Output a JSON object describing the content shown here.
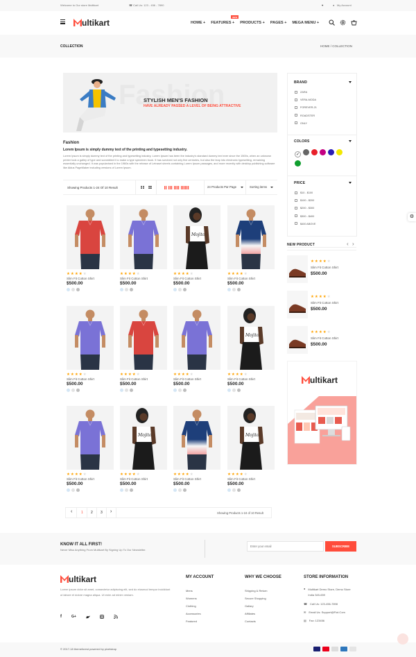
{
  "topbar": {
    "welcome": "Welcome to Our store Multikart",
    "phone": "Call Us: 123 - 456 - 7890",
    "account": "My Account"
  },
  "brand": {
    "logo_tail": "ultikart"
  },
  "nav": {
    "items": [
      "HOME",
      "FEATURES",
      "PRODUCTS",
      "PAGES",
      "MEGA MENU"
    ],
    "features_badge": "NEW"
  },
  "breadcrumb": {
    "title": "COLLECTION",
    "home": "HOME",
    "sep": "/",
    "current": "COLLECTION"
  },
  "banner": {
    "title": "STYLISH MEN'S FASHION",
    "subtitle": "HAVE ALREADY PASSED A LEVEL OF BEING ATTRACTIVE",
    "watermark": "Fashion"
  },
  "intro": {
    "heading": "Fashion",
    "subheading": "Lorem Ipsum is simply dummy text of the printing and typesetting industry.",
    "body": "Lorem Ipsum is simply dummy text of the printing and typesetting industry. Lorem Ipsum has been the industry's standard dummy text ever since the 1500s, when an unknown printer took a galley of type and scrambled it to make a type specimen book. It has survived not only five centuries, but also the leap into electronic typesetting, remaining essentially unchanged. It was popularised in the 1960s with the release of Letraset sheets containing Lorem Ipsum passages, and more recently with desktop publishing software like Aldus PageMaker including versions of Lorem Ipsum."
  },
  "toolbar": {
    "showing": "Showing Products 1-24 Of 10 Result",
    "per_page": "24 Products Par Page",
    "sorting": "Sorting items"
  },
  "sidebar": {
    "brand_title": "BRAND",
    "brands": [
      "ZARA",
      "VERA-MODA",
      "FOREVER-21",
      "ROADSTER",
      "ONLY"
    ],
    "colors_title": "COLORS",
    "colors": [
      "#ffffff",
      "#666666",
      "#e8202a",
      "#c40082",
      "#2a1db4",
      "#f2e800",
      "#0f9e2e"
    ],
    "price_title": "PRICE",
    "prices": [
      "$10 - $100",
      "$100 - $200",
      "$200 - $300",
      "$300 - $400",
      "$400 ABOVE"
    ],
    "new_product_title": "NEW PRODUCT",
    "new_products": [
      {
        "name": "Slim Fit Cotton Shirt",
        "price": "$500.00",
        "rating": 4
      },
      {
        "name": "Slim Fit Cotton Shirt",
        "price": "$500.00",
        "rating": 4
      },
      {
        "name": "Slim Fit Cotton Shirt",
        "price": "$500.00",
        "rating": 4
      }
    ],
    "ad_logo_tail": "ultikart"
  },
  "products": [
    {
      "name": "Slim Fit Cotton Shirt",
      "price": "$500.00",
      "rating": 4,
      "kind": "red-polo"
    },
    {
      "name": "Slim Fit Cotton Shirt",
      "price": "$500.00",
      "rating": 4,
      "kind": "blue-polo"
    },
    {
      "name": "Slim Fit Cotton Shirt",
      "price": "$500.00",
      "rating": 4,
      "kind": "woman"
    },
    {
      "name": "Slim Fit Cotton Shirt",
      "price": "$500.00",
      "rating": 4,
      "kind": "ombre-polo"
    },
    {
      "name": "Slim Fit Cotton Shirt",
      "price": "$500.00",
      "rating": 4,
      "kind": "blue-polo"
    },
    {
      "name": "Slim Fit Cotton Shirt",
      "price": "$500.00",
      "rating": 4,
      "kind": "red-polo"
    },
    {
      "name": "Slim Fit Cotton Shirt",
      "price": "$500.00",
      "rating": 4,
      "kind": "blue-polo"
    },
    {
      "name": "Slim Fit Cotton Shirt",
      "price": "$500.00",
      "rating": 4,
      "kind": "woman"
    },
    {
      "name": "Slim Fit Cotton Shirt",
      "price": "$500.00",
      "rating": 4,
      "kind": "blue-polo"
    },
    {
      "name": "Slim Fit Cotton Shirt",
      "price": "$500.00",
      "rating": 4,
      "kind": "woman"
    },
    {
      "name": "Slim Fit Cotton Shirt",
      "price": "$500.00",
      "rating": 4,
      "kind": "ombre-polo"
    },
    {
      "name": "Slim Fit Cotton Shirt",
      "price": "$500.00",
      "rating": 4,
      "kind": "woman"
    }
  ],
  "pagination": {
    "pages": [
      "1",
      "2",
      "3"
    ],
    "active": "1",
    "prev": "‹",
    "next": "›",
    "result": "Showing Products 1-24 of 10 Result"
  },
  "newsletter": {
    "title": "KNOW IT ALL FIRST!",
    "text": "Never Miss Anything From Multikart By Signing Up To Our Newsletter.",
    "placeholder": "Enter your email",
    "button": "SUBSCRIBE"
  },
  "footer": {
    "about": "Lorem ipsum dolor sit amet, consectetur adipiscing elit, sed do eiusmod tempor incididunt ut labore et dolore magna aliqua. Ut enim ad minim veniam.",
    "my_account_title": "MY ACCOUNT",
    "my_account": [
      "Mens",
      "Womens",
      "Clothing",
      "Accessories",
      "Featured"
    ],
    "why_title": "WHY WE CHOOSE",
    "why": [
      "Shipping & Return",
      "Secure Shopping",
      "Gallary",
      "Affiliates",
      "Contacts"
    ],
    "store_title": "STORE INFORMATION",
    "store": [
      "Multikart Demo Store, Demo Store India 345-659",
      "Call Us: 123-456-7898",
      "Email Us: Support@Fiot.Com",
      "Fax: 123456"
    ],
    "copyright": "© 2017-18 themeforest powered by pixelstrap"
  }
}
